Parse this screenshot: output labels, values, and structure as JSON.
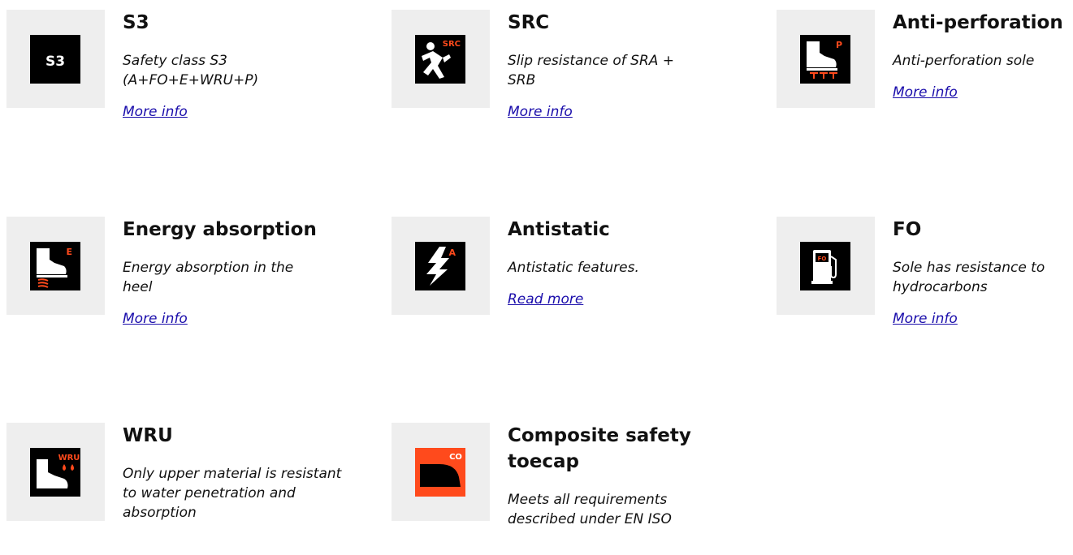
{
  "colors": {
    "icon_accent": "#ff4a1c",
    "link": "#1a0dab",
    "icon_background": "#eeeeee"
  },
  "features": [
    {
      "icon": "s3-badge-icon",
      "title": "S3",
      "description": "Safety class S3 (A+FO+E+WRU+P)",
      "link": "More info"
    },
    {
      "icon": "slip-resistance-src-icon",
      "title": "SRC",
      "description": "Slip resistance of SRA + SRB",
      "link": "More info"
    },
    {
      "icon": "anti-perforation-boot-icon",
      "title": "Anti-perforation",
      "description": "Anti-perforation sole",
      "link": "More info"
    },
    {
      "icon": "energy-absorption-boot-icon",
      "title": "Energy absorption",
      "description": "Energy absorption in the heel",
      "link": "More info"
    },
    {
      "icon": "antistatic-lightning-icon",
      "title": "Antistatic",
      "description": "Antistatic features.",
      "link": "Read more"
    },
    {
      "icon": "fuel-pump-icon",
      "title": "FO",
      "description": "Sole has resistance to hydrocarbons",
      "link": "More info"
    },
    {
      "icon": "water-resistant-boot-icon",
      "title": "WRU",
      "description": "Only upper material is resistant to water penetration and absorption",
      "link": ""
    },
    {
      "icon": "composite-toecap-icon",
      "title": "Composite safety toecap",
      "description": "Meets all requirements described under EN ISO",
      "link": ""
    }
  ]
}
